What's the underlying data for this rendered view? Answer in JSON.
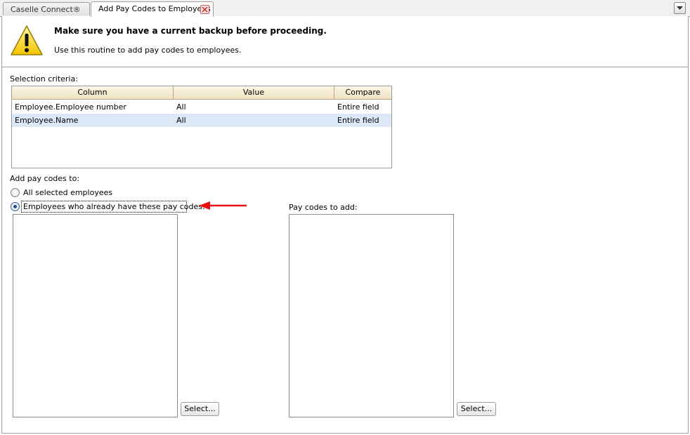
{
  "tabs": [
    {
      "label": "Caselle Connect®",
      "active": false
    },
    {
      "label": "Add Pay Codes to Employees",
      "active": true
    }
  ],
  "header": {
    "title": "Make sure you have a current backup before proceeding.",
    "subtitle": "Use this routine to add pay codes to employees."
  },
  "criteria": {
    "label": "Selection criteria:",
    "columns": [
      "Column",
      "Value",
      "Compare"
    ],
    "rows": [
      {
        "column": "Employee.Employee number",
        "value": "All",
        "compare": "Entire field"
      },
      {
        "column": "Employee.Name",
        "value": "All",
        "compare": "Entire field"
      }
    ]
  },
  "add_to": {
    "label": "Add pay codes to:",
    "option_all": "All selected employees",
    "option_existing": "Employees who already have these pay codes:",
    "selected": "existing"
  },
  "pay_codes": {
    "label": "Pay codes to add:"
  },
  "buttons": {
    "select_left": "Select...",
    "select_right": "Select..."
  },
  "colors": {
    "arrow": "#e81010",
    "selected_row": "#dce8f8"
  }
}
